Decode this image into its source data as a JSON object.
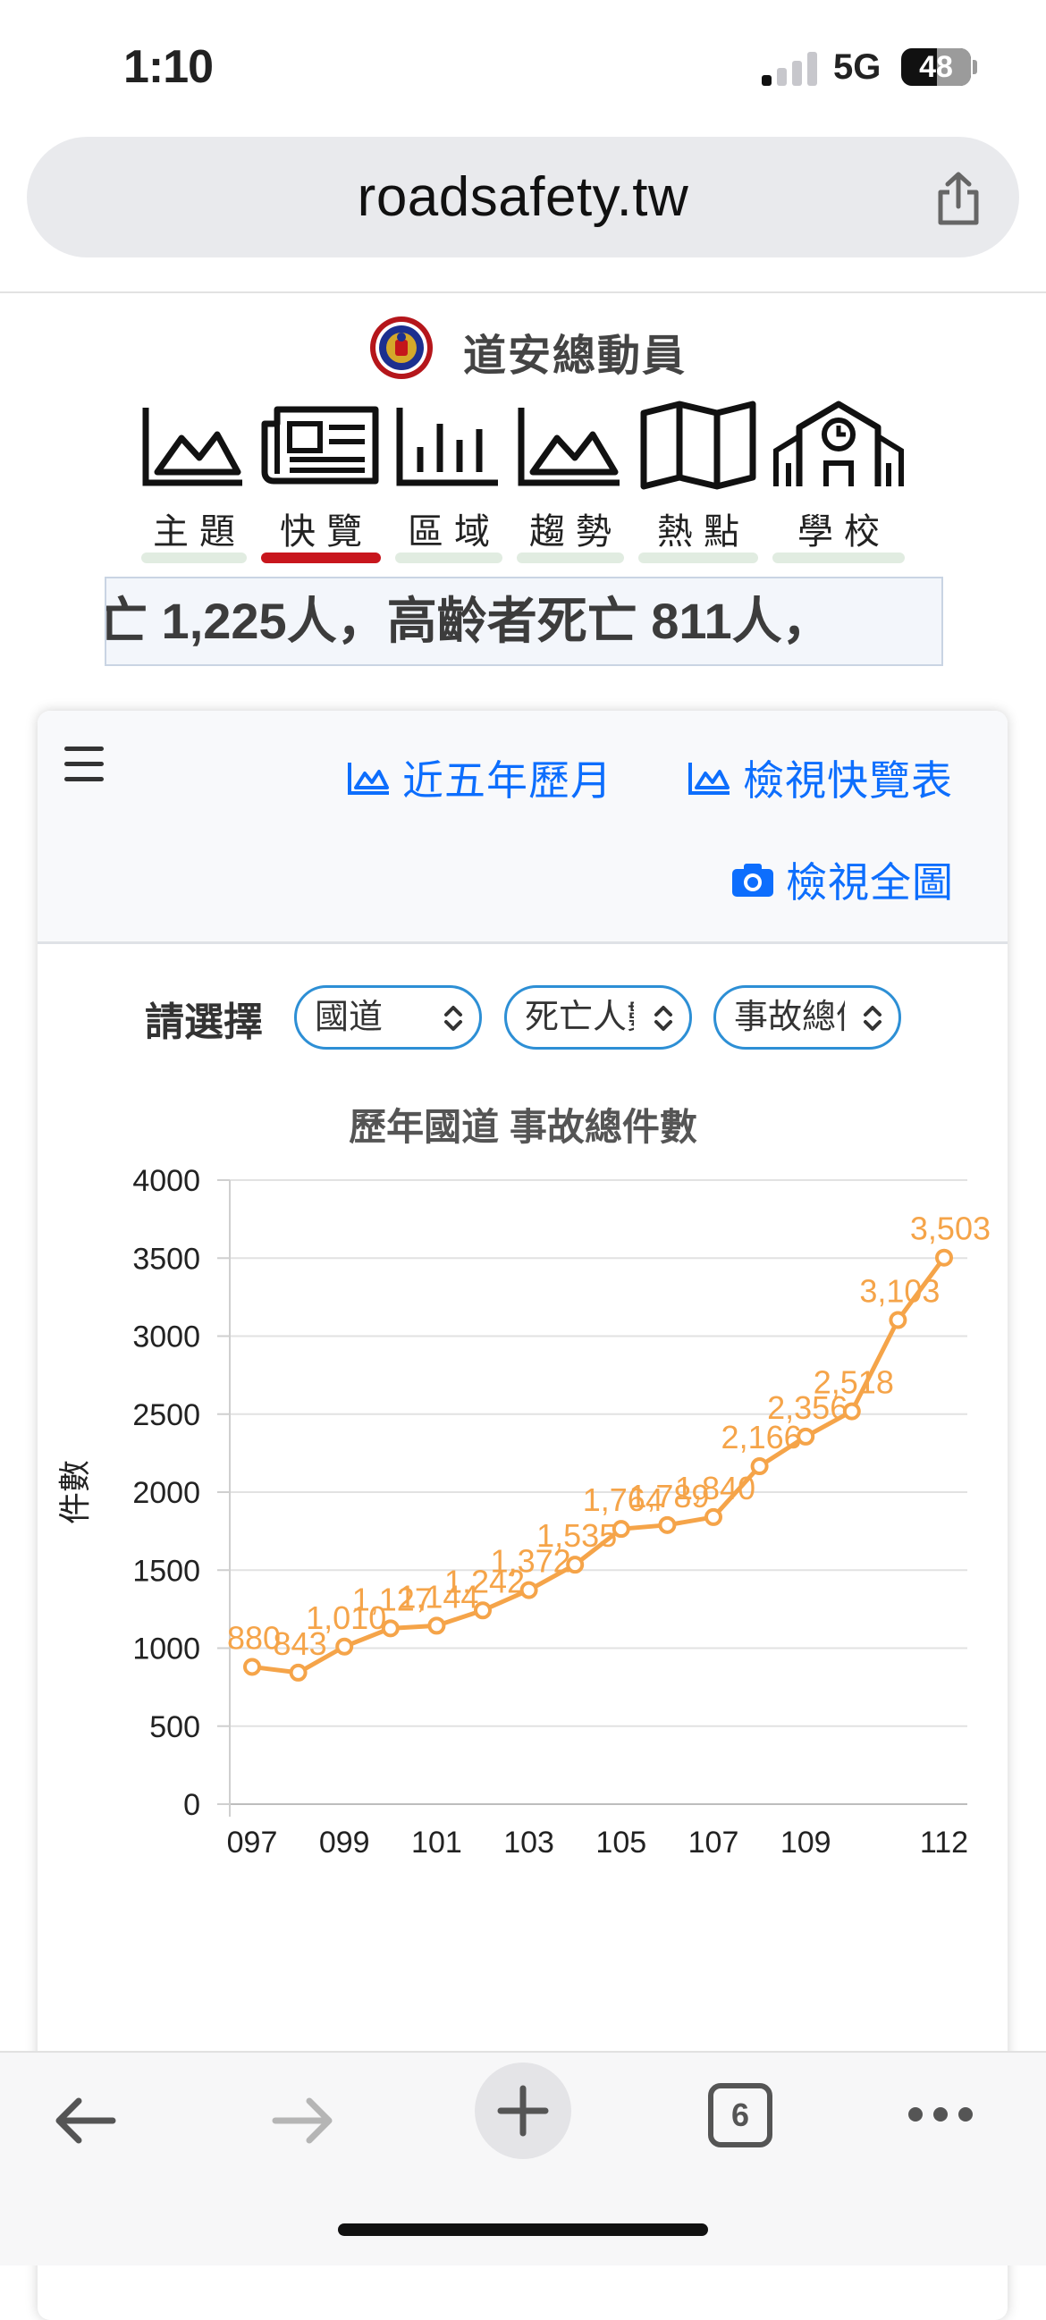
{
  "status_bar": {
    "time": "1:10",
    "network": "5G",
    "battery": "48"
  },
  "browser": {
    "url": "roadsafety.tw",
    "tab_count": "6"
  },
  "site": {
    "title": "道安總動員",
    "nav": [
      {
        "label": "主題",
        "icon": "area-chart-icon",
        "active": false
      },
      {
        "label": "快覽",
        "icon": "newspaper-icon",
        "active": true
      },
      {
        "label": "區域",
        "icon": "bar-chart-icon",
        "active": false
      },
      {
        "label": "趨勢",
        "icon": "trend-chart-icon",
        "active": false
      },
      {
        "label": "熱點",
        "icon": "map-icon",
        "active": false
      },
      {
        "label": "學校",
        "icon": "school-icon",
        "active": false
      }
    ],
    "ticker": "亡 1,225人，高齡者死亡 811人，"
  },
  "card": {
    "links": {
      "five_year": "近五年歷月",
      "view_table": "檢視快覽表",
      "view_full": "檢視全圖"
    },
    "filter_label": "請選擇",
    "selects": [
      "國道",
      "死亡人數",
      "事故總件數"
    ]
  },
  "colors": {
    "accent": "#0d6efd",
    "series": "#f5a449",
    "active_tab": "#c8161d"
  },
  "chart_data": {
    "type": "line",
    "title": "歷年國道 事故總件數",
    "ylabel": "件數",
    "xlabel": "",
    "x": [
      "097",
      "098",
      "099",
      "100",
      "101",
      "102",
      "103",
      "104",
      "105",
      "106",
      "107",
      "108",
      "109",
      "110",
      "111",
      "112"
    ],
    "xtick_labels": [
      "097",
      "099",
      "101",
      "103",
      "105",
      "107",
      "109",
      "112"
    ],
    "series": [
      {
        "values": [
          880,
          843,
          1010,
          1127,
          1144,
          1242,
          1372,
          1535,
          1764,
          1789,
          1840,
          2166,
          2356,
          2518,
          3103,
          3503
        ],
        "labels": [
          "880",
          "843",
          "1,010",
          "1,127",
          "1,144",
          "1,242",
          "1,372",
          "1,535",
          "1,764",
          "1,789",
          "1,840",
          "2,166",
          "2,356",
          "2,518",
          "3,103",
          "3,503"
        ]
      }
    ],
    "ylim": [
      0,
      4000
    ],
    "yticks": [
      0,
      500,
      1000,
      1500,
      2000,
      2500,
      3000,
      3500,
      4000
    ],
    "grid": true,
    "legend": "none"
  }
}
